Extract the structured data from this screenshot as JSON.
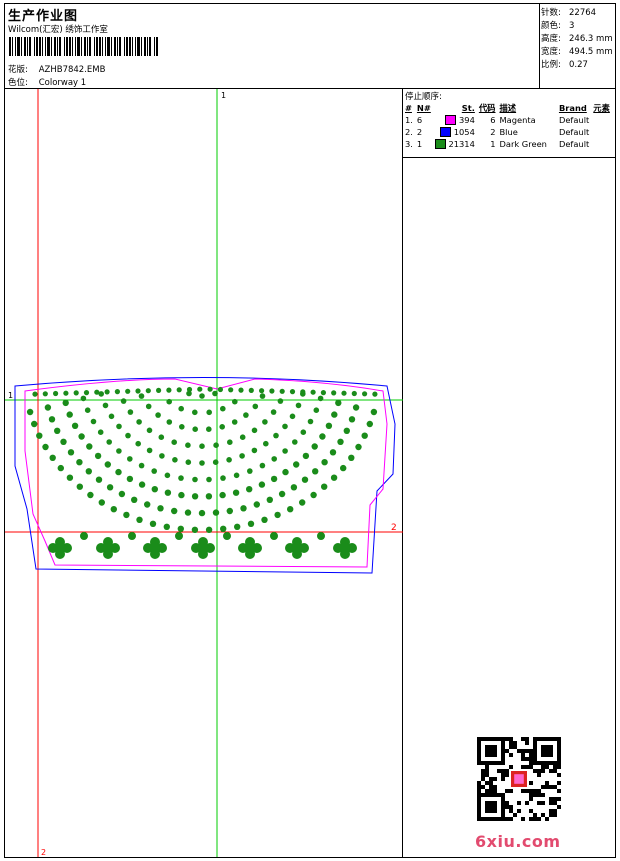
{
  "header": {
    "title": "生产作业图",
    "company": "Wilcom(汇宏) 绣饰工作室",
    "pattern_label": "花版:",
    "pattern_value": "AZHB7842.EMB",
    "color_label": "色位:",
    "color_value": "Colorway 1"
  },
  "stats": [
    {
      "label": "针数:",
      "value": "22764"
    },
    {
      "label": "颜色:",
      "value": "3"
    },
    {
      "label": "高度:",
      "value": "246.3 mm"
    },
    {
      "label": "宽度:",
      "value": "494.5 mm"
    },
    {
      "label": "比例:",
      "value": "0.27"
    }
  ],
  "stop_sequence": {
    "title": "停止顺序:",
    "headers": [
      "#",
      "N#",
      "St.",
      "代码",
      "描述",
      "Brand",
      "元素"
    ],
    "rows": [
      {
        "idx": "1.",
        "n": "6",
        "color": "#ff00ff",
        "st": "394",
        "code": "6",
        "desc": "Magenta",
        "brand": "Default"
      },
      {
        "idx": "2.",
        "n": "2",
        "color": "#0000ff",
        "st": "1054",
        "code": "2",
        "desc": "Blue",
        "brand": "Default"
      },
      {
        "idx": "3.",
        "n": "1",
        "color": "#1a8c1a",
        "st": "21314",
        "code": "1",
        "desc": "Dark Green",
        "brand": "Default"
      }
    ]
  },
  "markers": {
    "v1": "1",
    "h1": "1",
    "h2": "2",
    "v2": "2"
  },
  "colors": {
    "green": "#1a8c1a",
    "magenta": "#ff00ff",
    "blue": "#0000ff",
    "red": "#ff0000",
    "guide": "#00cc00"
  },
  "watermark": "6xiu.com"
}
